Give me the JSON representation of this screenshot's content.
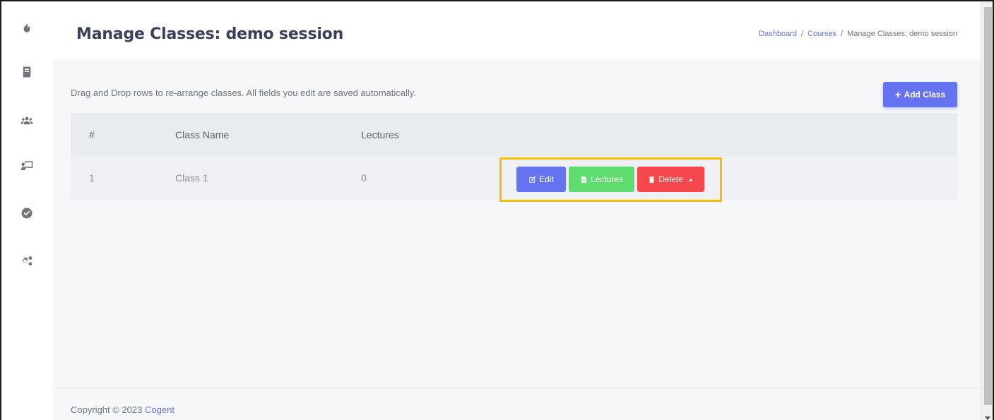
{
  "header": {
    "title": "Manage Classes: demo session",
    "breadcrumb": [
      {
        "label": "Dashboard"
      },
      {
        "label": "Courses"
      },
      {
        "label": "Manage Classes: demo session"
      }
    ],
    "separator": "/"
  },
  "main": {
    "hint": "Drag and Drop rows to re-arrange classes. All fields you edit are saved automatically.",
    "add_button": {
      "icon": "plus-icon",
      "label": "Add Class"
    },
    "table": {
      "columns": [
        "#",
        "Class Name",
        "Lectures"
      ],
      "rows": [
        {
          "index": "1",
          "name": "Class 1",
          "lectures": "0"
        }
      ]
    },
    "row_actions": {
      "edit": {
        "icon": "edit-icon",
        "label": "Edit"
      },
      "lectures": {
        "icon": "file-icon",
        "label": "Lectures"
      },
      "delete": {
        "icon": "trash-icon",
        "label": "Delete",
        "caret": "caret-up-icon"
      }
    }
  },
  "footer": {
    "copyright_prefix": "Copyright © 2023",
    "brand": "Cogent"
  },
  "sidebar": {
    "icons": [
      "flame-icon",
      "book-icon",
      "users-icon",
      "teacher-icon",
      "check-circle-icon",
      "cogs-icon"
    ]
  },
  "colors": {
    "primary": "#6673f0",
    "success": "#5fdc6e",
    "danger": "#f5474c",
    "highlight": "#f5c000"
  }
}
